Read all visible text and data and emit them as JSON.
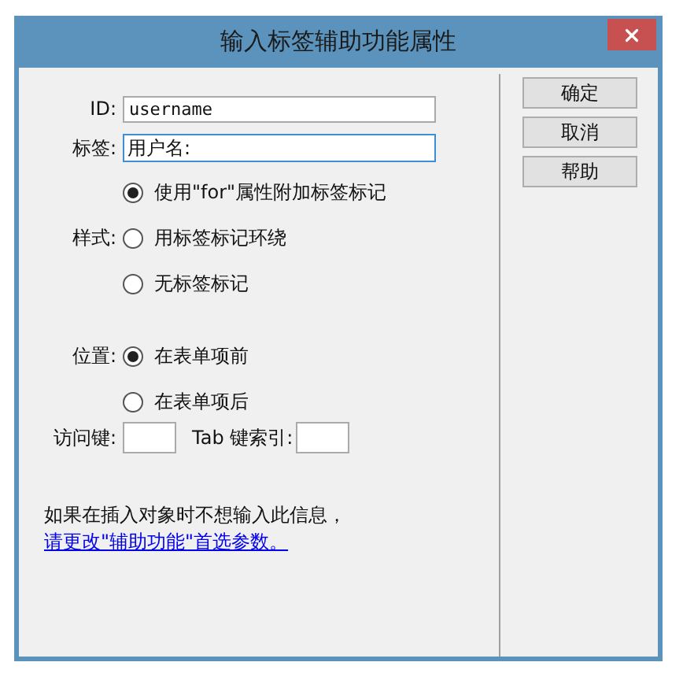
{
  "window": {
    "title": "输入标签辅助功能属性"
  },
  "id_field": {
    "label": "ID:",
    "value": "username"
  },
  "label_field": {
    "label": "标签:",
    "value": "用户名:",
    "focused": true
  },
  "style_group": {
    "label": "样式:",
    "options": [
      {
        "label": "使用\"for\"属性附加标签标记",
        "selected": true
      },
      {
        "label": "用标签标记环绕",
        "selected": false
      },
      {
        "label": "无标签标记",
        "selected": false
      }
    ]
  },
  "position_group": {
    "label": "位置:",
    "options": [
      {
        "label": "在表单项前",
        "selected": true
      },
      {
        "label": "在表单项后",
        "selected": false
      }
    ]
  },
  "access_key": {
    "label": "访问键:"
  },
  "tab_index": {
    "label": "Tab 键索引:"
  },
  "note": {
    "text": "如果在插入对象时不想输入此信息，",
    "link": "请更改\"辅助功能\"首选参数。"
  },
  "buttons": [
    "确定",
    "取消",
    "帮助"
  ]
}
